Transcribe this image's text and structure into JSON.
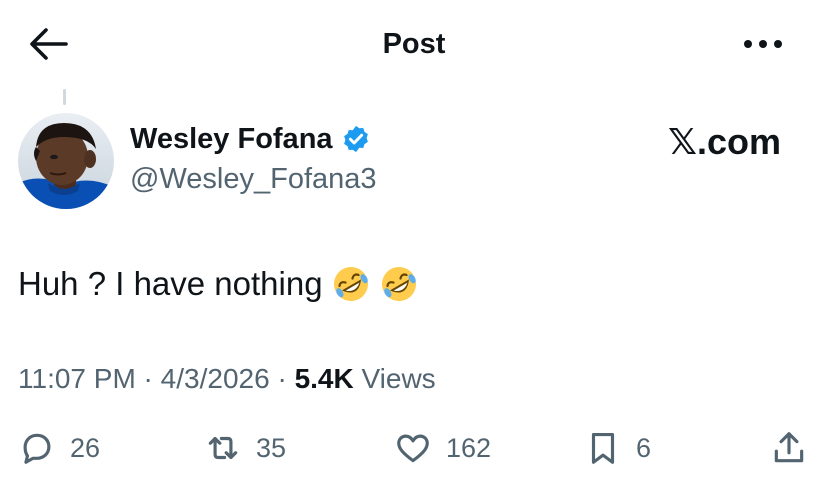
{
  "header": {
    "title": "Post",
    "back_icon": "arrow-left-icon",
    "more_icon": "more-horizontal-icon"
  },
  "author": {
    "display_name": "Wesley Fofana",
    "handle": "@Wesley_Fofana3",
    "verified": true,
    "verified_color": "#1d9bf0"
  },
  "watermark": "𝕏.com",
  "tweet": {
    "text": "Huh ? I have nothing",
    "emojis": [
      "rolling-on-floor-laughing-emoji",
      "rolling-on-floor-laughing-emoji"
    ]
  },
  "meta": {
    "time": "11:07 PM",
    "sep1": " · ",
    "date": "4/3/2026",
    "sep2": " · ",
    "views_count": "5.4K",
    "views_label": " Views"
  },
  "actions": {
    "replies": "26",
    "reposts": "35",
    "likes": "162",
    "bookmarks": "6"
  },
  "colors": {
    "text": "#0f1419",
    "secondary": "#536471",
    "accent": "#1d9bf0"
  }
}
